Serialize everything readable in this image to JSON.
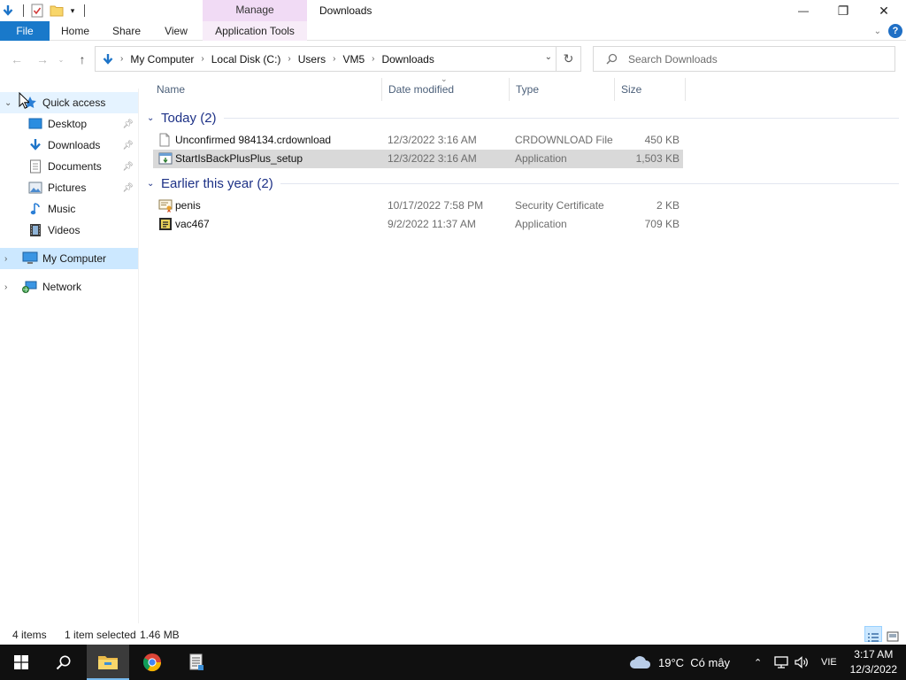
{
  "window": {
    "title": "Downloads",
    "context_tab_group": "Manage",
    "controls": {
      "minimize": "—",
      "restore": "❐",
      "close": "✕"
    }
  },
  "ribbon": {
    "tabs": [
      {
        "label": "File"
      },
      {
        "label": "Home"
      },
      {
        "label": "Share"
      },
      {
        "label": "View"
      },
      {
        "label": "Application Tools"
      }
    ]
  },
  "address": {
    "crumbs": [
      "My Computer",
      "Local Disk (C:)",
      "Users",
      "VM5",
      "Downloads"
    ],
    "search_placeholder": "Search Downloads"
  },
  "nav_pane": {
    "quick_access": "Quick access",
    "quick_items": [
      {
        "label": "Desktop",
        "icon": "desktop-icon"
      },
      {
        "label": "Downloads",
        "icon": "downloads-icon"
      },
      {
        "label": "Documents",
        "icon": "documents-icon"
      },
      {
        "label": "Pictures",
        "icon": "pictures-icon"
      },
      {
        "label": "Music",
        "icon": "music-icon"
      },
      {
        "label": "Videos",
        "icon": "videos-icon"
      }
    ],
    "this_pc": "My Computer",
    "network": "Network"
  },
  "columns": {
    "name": "Name",
    "date": "Date modified",
    "type": "Type",
    "size": "Size"
  },
  "groups": [
    {
      "title": "Today (2)",
      "files": [
        {
          "name": "Unconfirmed 984134.crdownload",
          "date": "12/3/2022 3:16 AM",
          "type": "CRDOWNLOAD File",
          "size": "450 KB",
          "icon": "blank-file-icon"
        },
        {
          "name": "StartIsBackPlusPlus_setup",
          "date": "12/3/2022 3:16 AM",
          "type": "Application",
          "size": "1,503 KB",
          "icon": "installer-icon"
        }
      ]
    },
    {
      "title": "Earlier this year (2)",
      "files": [
        {
          "name": "penis",
          "date": "10/17/2022 7:58 PM",
          "type": "Security Certificate",
          "size": "2 KB",
          "icon": "certificate-icon"
        },
        {
          "name": "vac467",
          "date": "9/2/2022 11:37 AM",
          "type": "Application",
          "size": "709 KB",
          "icon": "application-icon"
        }
      ]
    }
  ],
  "status": {
    "count": "4 items",
    "selection": "1 item selected",
    "selection_size": "1.46 MB"
  },
  "taskbar": {
    "weather": "19°C  Có mây",
    "language": "VIE",
    "time": "3:17 AM",
    "date": "12/3/2022"
  },
  "colors": {
    "accent": "#1979ca",
    "selection": "#cce8ff",
    "context_tab": "#f1dbf5",
    "group_title": "#1e3287"
  }
}
